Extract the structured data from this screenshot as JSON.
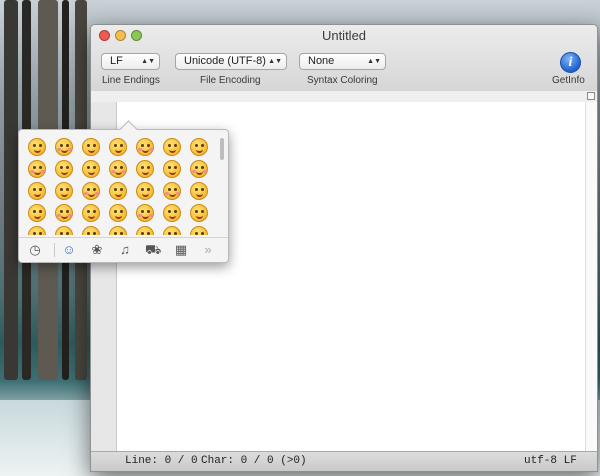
{
  "window": {
    "title": "Untitled"
  },
  "toolbar": {
    "line_endings": {
      "value": "LF",
      "label": "Line Endings"
    },
    "file_encoding": {
      "value": "Unicode (UTF-8)",
      "label": "File Encoding"
    },
    "syntax_coloring": {
      "value": "None",
      "label": "Syntax Coloring"
    },
    "get_info": {
      "label": "GetInfo",
      "icon": "info-icon"
    }
  },
  "statusbar": {
    "line": "Line: 0 / 0",
    "char": "Char: 0 / 0 (>0)",
    "encoding": "utf-8 LF"
  },
  "emoji_palette": {
    "tabs": [
      {
        "name": "recents",
        "icon": "clock-icon"
      },
      {
        "name": "people",
        "icon": "smiley-icon",
        "selected": true
      },
      {
        "name": "nature",
        "icon": "flower-icon"
      },
      {
        "name": "objects",
        "icon": "bell-icon"
      },
      {
        "name": "places",
        "icon": "car-icon"
      },
      {
        "name": "symbols",
        "icon": "symbols-icon"
      },
      {
        "name": "more",
        "icon": "chevron-right-icon"
      }
    ]
  },
  "colors": {
    "accent_blue": "#2a6fd6",
    "close": "#ee5b51",
    "minimize": "#f4be4f",
    "zoom": "#8ac853"
  }
}
